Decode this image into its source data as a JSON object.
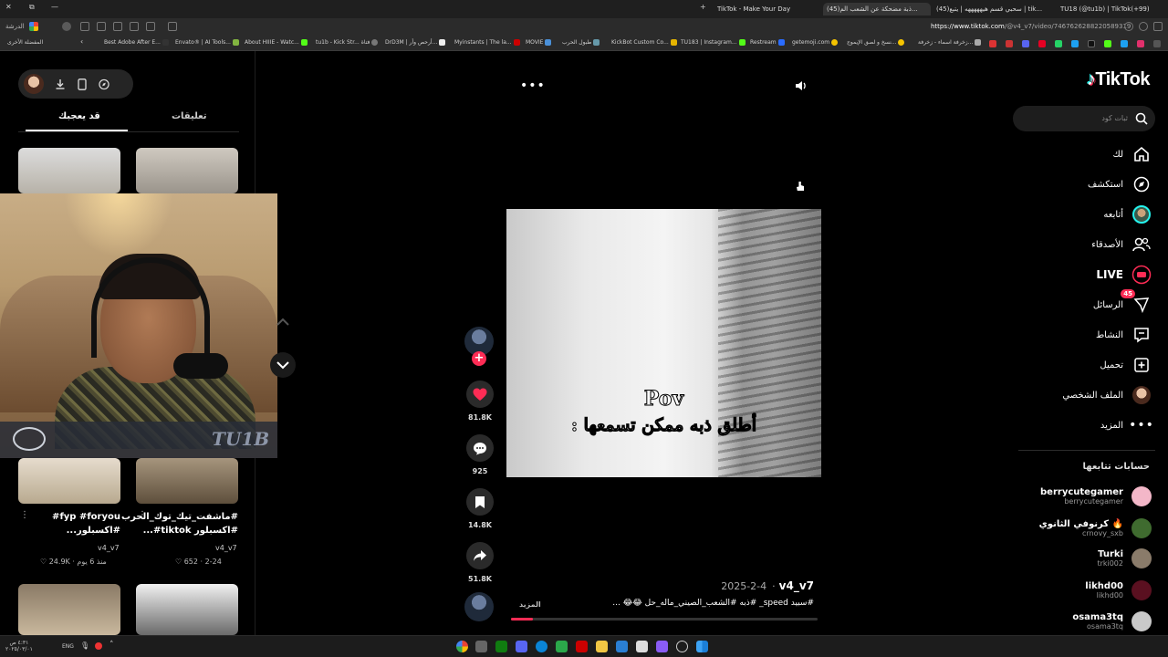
{
  "browser": {
    "tabs": [
      {
        "label": "TikTok - Make Your Day",
        "active": false
      },
      {
        "label": "(45)ذبة مضحكة عن الشعب الم...",
        "active": true
      },
      {
        "label": "(45)سحبي قسم هيهههههه | يتبع | tik...",
        "active": false
      },
      {
        "label": "TU18 (@tu1b) | TikTok(+99)",
        "active": false
      }
    ],
    "url_host": "https://www.tiktok.com",
    "url_path": "/@v4_v7/video/7467626288220589319",
    "bookmarks_folder": "المفضلة الأخرى",
    "bookmarks": [
      "Best Adobe After E...",
      "Envato® | AI Tools...",
      "About HIIIE - Watc...",
      "tu1b - Kick Str... فتاة",
      "DrD3M | أرحص وأر...",
      "Myinstants | The la...",
      "MOVIE",
      "طبول الحرب",
      "KickBot Custom Co...",
      "TU183 | Instagram...",
      "Restream",
      "getemoji.com",
      "نسخ و لصق الإيموج...",
      "زخرفة اسماء - زخرفة..."
    ],
    "profile_label": "الدرشة"
  },
  "tiktok": {
    "logo": "TikTok",
    "search_placeholder": "ثبات كود",
    "nav": [
      {
        "label": "لك",
        "icon": "home-icon"
      },
      {
        "label": "استكشف",
        "icon": "compass-icon"
      },
      {
        "label": "أتابعه",
        "icon": "following-avatar"
      },
      {
        "label": "الأصدقاء",
        "icon": "friends-icon"
      },
      {
        "label": "LIVE",
        "icon": "live-icon"
      },
      {
        "label": "الرسائل",
        "icon": "messages-icon",
        "badge": "45"
      },
      {
        "label": "النشاط",
        "icon": "activity-icon"
      },
      {
        "label": "تحميل",
        "icon": "upload-icon"
      },
      {
        "label": "الملف الشخصي",
        "icon": "profile-avatar"
      },
      {
        "label": "المزيد",
        "icon": "more-icon"
      }
    ],
    "following_title": "حسابات تتابعها",
    "following": [
      {
        "name": "berrycutegamer",
        "handle": "berrycutegamer",
        "color": "#f3b7c8"
      },
      {
        "name": "كرنوفي الثانوي 🔥",
        "handle": "crnovy_sxb",
        "color": "#3f6b2f"
      },
      {
        "name": "Turki",
        "handle": "trki002",
        "color": "#8a7b6a"
      },
      {
        "name": "likhd00",
        "handle": "likhd00",
        "color": "#5a1020"
      },
      {
        "name": "osama3tq",
        "handle": "osama3tq",
        "color": "#c9c9c9"
      }
    ],
    "video": {
      "overlay_title": "Pov",
      "overlay_text": "أطلق ذبه ممكن تسمعها :",
      "author": "v4_v7",
      "date": "2025-2-4",
      "caption": "#سبيد speed_ #ذبه #الشعب_الصيني_ماله_حل 😂😂 ...",
      "more_label": "المزيد",
      "progress": 0.07
    },
    "actions": {
      "likes": "81.8K",
      "comments": "925",
      "saves": "14.8K",
      "shares": "51.8K"
    },
    "panel": {
      "tab_comments": "تعليقات",
      "tab_like": "قد يعجبك",
      "videos": [
        {
          "caption": "fyp #foryou# #اكسبلور...",
          "author": "v4_v7",
          "likes": "24.9K",
          "time": "منذ 6 يوم"
        },
        {
          "caption": "#ماشفت_تيك_توك_الحرب #اكسبلور tiktok#...",
          "author": "v4_v7",
          "likes": "652",
          "time": "2-24"
        }
      ],
      "webcam_brand": "TU1B"
    }
  },
  "taskbar": {
    "time": "٤:٣١ ص",
    "date": "٢٠٢٥/٠٣/٠١",
    "lang": "ENG"
  },
  "colors": {
    "accent": "#fe2c55",
    "background": "#000000",
    "panel": "#252525"
  }
}
